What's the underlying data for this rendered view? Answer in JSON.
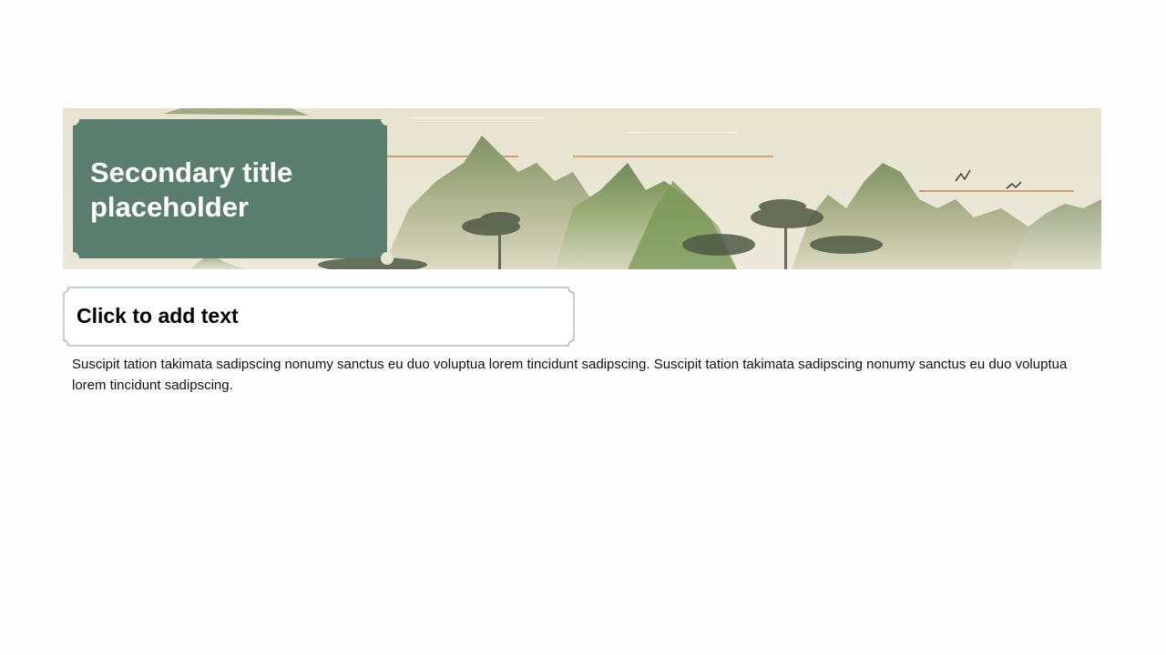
{
  "slide": {
    "title": "Secondary title placeholder",
    "subheading": "Click to add text",
    "body": "Suscipit tation takimata sadipscing nonumy sanctus eu duo voluptua lorem tincidunt sadipscing. Suscipit tation takimata sadipscing nonumy sanctus eu duo voluptua lorem tincidunt sadipscing."
  },
  "colors": {
    "title_panel": "#5a7e6e",
    "banner_sky": "#e9e5d3",
    "mountain_green": "#7d9460",
    "box_border": "#8aa197"
  }
}
